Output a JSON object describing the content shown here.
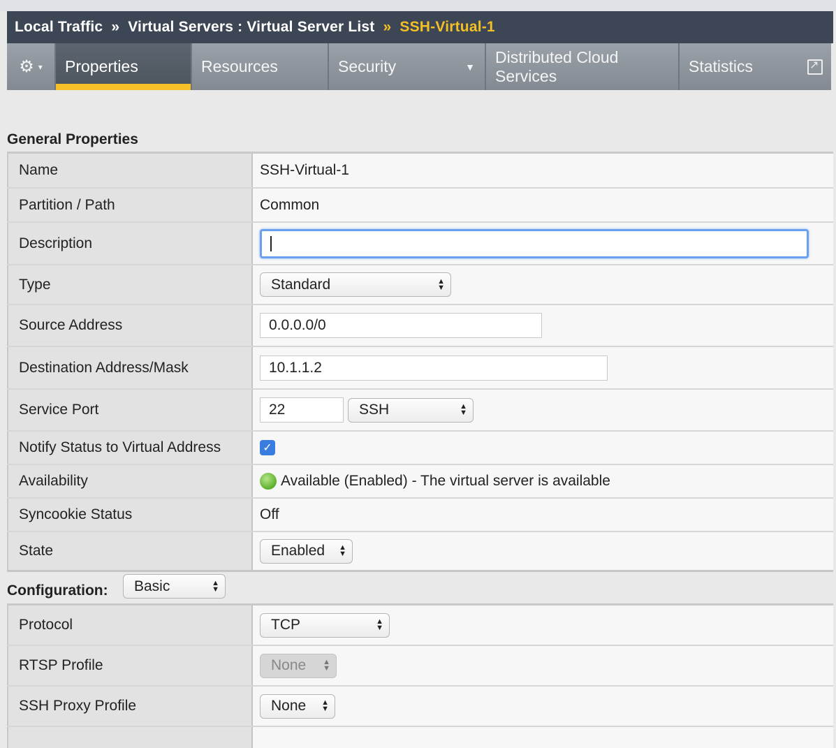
{
  "breadcrumb": {
    "part1": "Local Traffic",
    "sep1": "»",
    "part2": "Virtual Servers : Virtual Server List",
    "sep2": "»",
    "current": "SSH-Virtual-1"
  },
  "tabs": {
    "gear": "⚙",
    "gear_caret": "▾",
    "items": [
      {
        "label": "Properties"
      },
      {
        "label": "Resources"
      },
      {
        "label": "Security",
        "caret": "▼"
      },
      {
        "label": "Distributed Cloud Services"
      },
      {
        "label": "Statistics"
      }
    ]
  },
  "general": {
    "title": "General Properties",
    "rows": {
      "name": {
        "label": "Name",
        "value": "SSH-Virtual-1"
      },
      "partition": {
        "label": "Partition / Path",
        "value": "Common"
      },
      "description": {
        "label": "Description",
        "value": ""
      },
      "type": {
        "label": "Type",
        "value": "Standard"
      },
      "source": {
        "label": "Source Address",
        "value": "0.0.0.0/0"
      },
      "destination": {
        "label": "Destination Address/Mask",
        "value": "10.1.1.2"
      },
      "service_port": {
        "label": "Service Port",
        "port": "22",
        "protocol": "SSH"
      },
      "notify": {
        "label": "Notify Status to Virtual Address",
        "checked": true
      },
      "availability": {
        "label": "Availability",
        "value": "Available (Enabled) - The virtual server is available",
        "status_color": "#5cb02b"
      },
      "syncookie": {
        "label": "Syncookie Status",
        "value": "Off"
      },
      "state": {
        "label": "State",
        "value": "Enabled"
      }
    }
  },
  "configuration": {
    "title": "Configuration:",
    "mode": "Basic",
    "rows": {
      "protocol": {
        "label": "Protocol",
        "value": "TCP"
      },
      "rtsp": {
        "label": "RTSP Profile",
        "value": "None"
      },
      "ssh_proxy": {
        "label": "SSH Proxy Profile",
        "value": "None"
      }
    }
  },
  "colors": {
    "accent": "#f4c025",
    "header_bg": "#3d4654",
    "focus": "#6ba0f0"
  }
}
